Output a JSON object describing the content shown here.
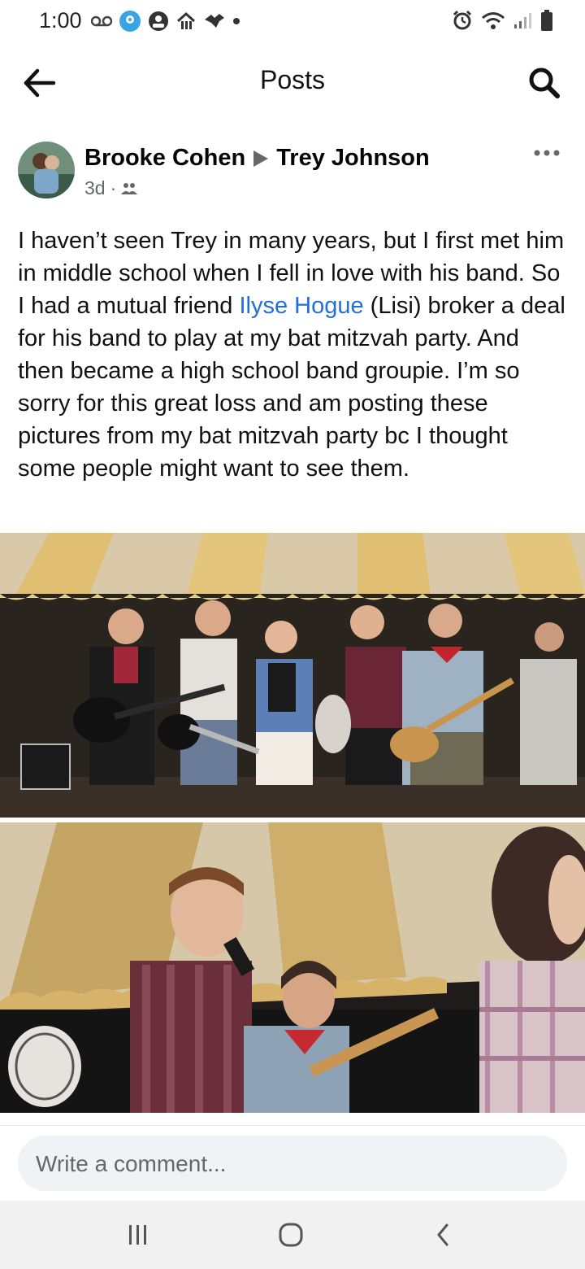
{
  "status_bar": {
    "time": "1:00",
    "left_icons": [
      "voicemail-icon",
      "maps-icon",
      "account-icon",
      "home-icon",
      "bird-icon",
      "dot-icon"
    ],
    "right_icons": [
      "alarm-icon",
      "wifi-icon",
      "signal-icon",
      "battery-icon"
    ]
  },
  "appbar": {
    "title": "Posts"
  },
  "post": {
    "author": "Brooke Cohen",
    "recipient": "Trey Johnson",
    "time": "3d",
    "separator": "·",
    "audience_icon": "friends-icon",
    "text_parts": {
      "before_link": "I haven’t seen Trey in many years, but I first met him in middle school when I fell in love with his band.  So I had a mutual friend ",
      "link": "Ilyse Hogue",
      "after_link": " (Lisi) broker a deal for his band to play at my bat mitzvah party. And then became a high school band groupie. I’m so sorry for this great loss and am posting these pictures from my bat mitzvah party bc I thought some people might want to see them."
    }
  },
  "comment": {
    "placeholder": "Write a comment..."
  },
  "colors": {
    "link": "#216fdb",
    "secondary_text": "#65676b",
    "comment_bg": "#f0f2f5",
    "nav_bg": "#f1f1f1"
  }
}
